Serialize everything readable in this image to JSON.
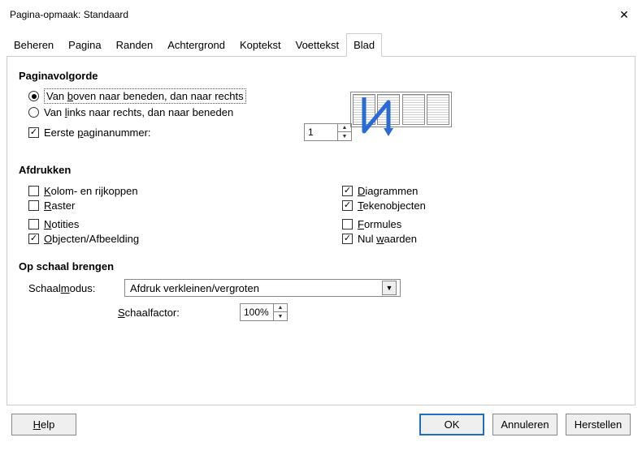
{
  "title": "Pagina-opmaak: Standaard",
  "tabs": [
    "Beheren",
    "Pagina",
    "Randen",
    "Achtergrond",
    "Koptekst",
    "Voettekst",
    "Blad"
  ],
  "active_tab": "Blad",
  "sections": {
    "page_order": {
      "title": "Paginavolgorde",
      "opt_top_down": "Van boven naar beneden, dan naar rechts",
      "opt_left_right": "Van links naar rechts, dan naar beneden",
      "first_page_label": "Eerste paginanummer:",
      "first_page_value": "1",
      "selected": "top_down",
      "first_page_checked": true
    },
    "print": {
      "title": "Afdrukken",
      "left": [
        {
          "key": "kolom",
          "label": "Kolom- en rijkoppen",
          "checked": false
        },
        {
          "key": "raster",
          "label": "Raster",
          "checked": false
        },
        {
          "key": "notities",
          "label": "Notities",
          "checked": false
        },
        {
          "key": "objecten",
          "label": "Objecten/Afbeelding",
          "checked": true
        }
      ],
      "right": [
        {
          "key": "diagrammen",
          "label": "Diagrammen",
          "checked": true
        },
        {
          "key": "tekenobjecten",
          "label": "Tekenobjecten",
          "checked": true
        },
        {
          "key": "formules",
          "label": "Formules",
          "checked": false
        },
        {
          "key": "nulwaarden",
          "label": "Nul waarden",
          "checked": true
        }
      ]
    },
    "scale": {
      "title": "Op schaal brengen",
      "mode_label": "Schaalmodus:",
      "mode_value": "Afdruk verkleinen/vergroten",
      "factor_label": "Schaalfactor:",
      "factor_value": "100%"
    }
  },
  "buttons": {
    "help": "Help",
    "ok": "OK",
    "cancel": "Annuleren",
    "reset": "Herstellen"
  }
}
